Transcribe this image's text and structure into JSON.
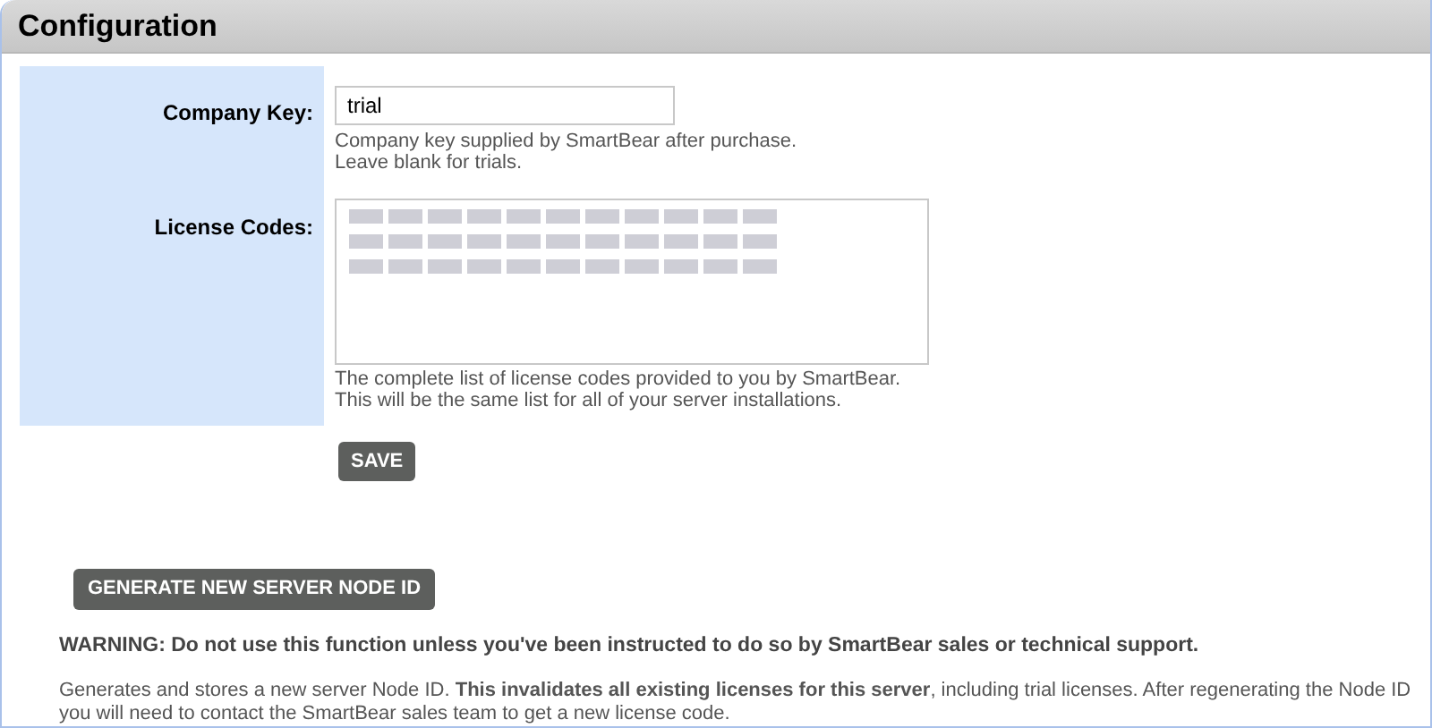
{
  "header": {
    "title": "Configuration"
  },
  "fields": [
    {
      "kind": "input",
      "label": "Company Key:",
      "value": "trial",
      "help": [
        "Company key supplied by SmartBear after purchase.",
        "Leave blank for trials."
      ]
    },
    {
      "kind": "textarea",
      "label": "License Codes:",
      "help": [
        "The complete list of license codes provided to you by SmartBear.",
        "This will be the same list for all of your server installations."
      ]
    }
  ],
  "save_button": "SAVE",
  "generate_button": "GENERATE NEW SERVER NODE ID",
  "warning": "WARNING: Do not use this function unless you've been instructed to do so by SmartBear sales or technical support.",
  "description": "Generates and stores a new server Node ID. **This invalidates all existing licenses for this server**, including trial licenses. After regenerating the Node ID you will need to contact the SmartBear sales team to get a new license code."
}
